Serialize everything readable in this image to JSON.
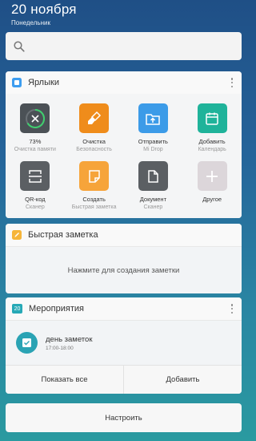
{
  "header": {
    "date": "20 ноября",
    "weekday": "Понедельник"
  },
  "search": {
    "icon": "search-icon"
  },
  "shortcuts": {
    "title": "Ярлыки",
    "items": [
      {
        "label": "73%",
        "sub": "Очистка памяти",
        "color": "#4b5156",
        "icon": "memory-clean-icon"
      },
      {
        "label": "Очистка",
        "sub": "Безопасность",
        "color": "#ef8c1b",
        "icon": "broom-icon"
      },
      {
        "label": "Отправить",
        "sub": "Mi Drop",
        "color": "#3c9be8",
        "icon": "upload-folder-icon"
      },
      {
        "label": "Добавить",
        "sub": "Календарь",
        "color": "#1fb39a",
        "icon": "calendar-icon"
      },
      {
        "label": "QR-код",
        "sub": "Сканер",
        "color": "#5b5f63",
        "icon": "qr-scan-icon"
      },
      {
        "label": "Создать",
        "sub": "Быстрая заметка",
        "color": "#f6a43a",
        "icon": "note-icon"
      },
      {
        "label": "Документ",
        "sub": "Сканер",
        "color": "#5b5f63",
        "icon": "document-icon"
      },
      {
        "label": "Другое",
        "sub": "",
        "color": "#dcd6da",
        "icon": "plus-icon"
      }
    ]
  },
  "quick_note": {
    "title": "Быстрая заметка",
    "hint": "Нажмите для создания заметки"
  },
  "events": {
    "title": "Мероприятия",
    "badge": "20",
    "item": {
      "title": "день заметок",
      "time": "17:00-18:00"
    },
    "show_all": "Показать все",
    "add": "Добавить"
  },
  "configure": "Настроить"
}
